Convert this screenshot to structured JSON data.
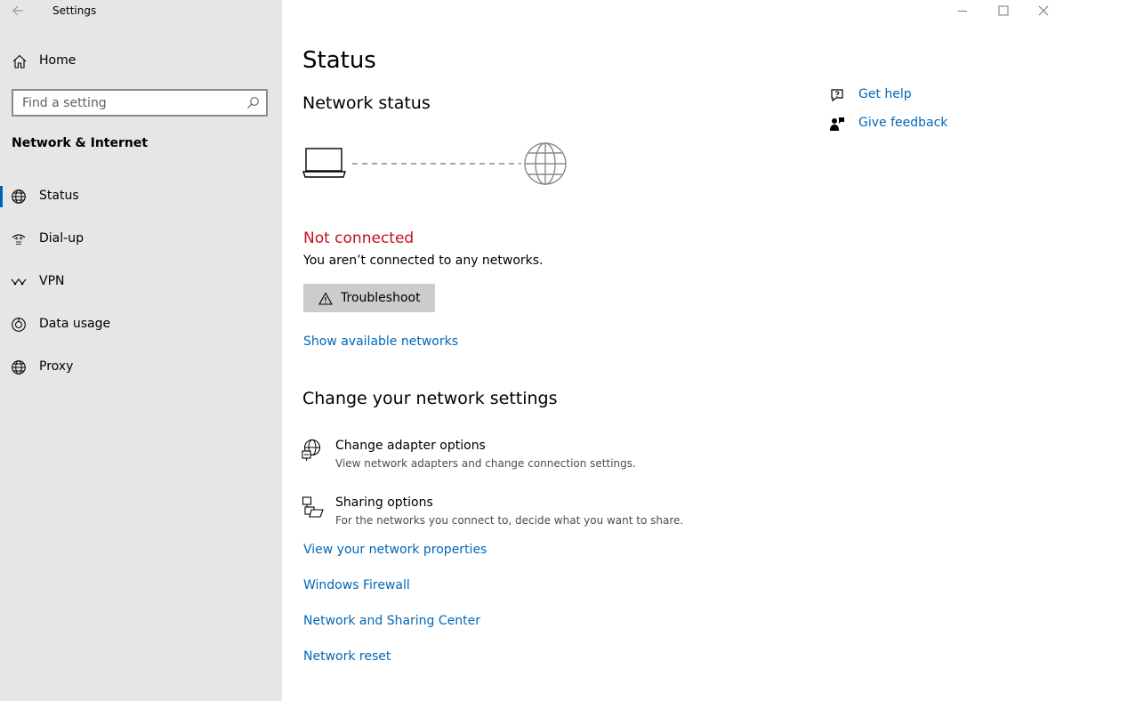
{
  "window": {
    "title": "Settings"
  },
  "sidebar": {
    "home_label": "Home",
    "search_placeholder": "Find a setting",
    "section_title": "Network & Internet",
    "items": [
      {
        "label": "Status",
        "icon": "globe-status-icon",
        "active": true
      },
      {
        "label": "Dial-up",
        "icon": "dial-up-icon",
        "active": false
      },
      {
        "label": "VPN",
        "icon": "vpn-icon",
        "active": false
      },
      {
        "label": "Data usage",
        "icon": "data-usage-icon",
        "active": false
      },
      {
        "label": "Proxy",
        "icon": "globe-icon",
        "active": false
      }
    ]
  },
  "main": {
    "page_title": "Status",
    "network_status_heading": "Network status",
    "connection_state": "Not connected",
    "connection_desc": "You aren’t connected to any networks.",
    "troubleshoot_label": "Troubleshoot",
    "show_networks_link": "Show available networks",
    "change_heading": "Change your network settings",
    "options": [
      {
        "title": "Change adapter options",
        "desc": "View network adapters and change connection settings.",
        "icon": "adapter-icon"
      },
      {
        "title": "Sharing options",
        "desc": "For the networks you connect to, decide what you want to share.",
        "icon": "sharing-icon"
      }
    ],
    "links": [
      "View your network properties",
      "Windows Firewall",
      "Network and Sharing Center",
      "Network reset"
    ]
  },
  "help": {
    "get_help": "Get help",
    "give_feedback": "Give feedback"
  },
  "colors": {
    "accent": "#0067b8",
    "error": "#c50f1f",
    "sidebar_bg": "#e6e6e6",
    "button_bg": "#cccccc"
  }
}
